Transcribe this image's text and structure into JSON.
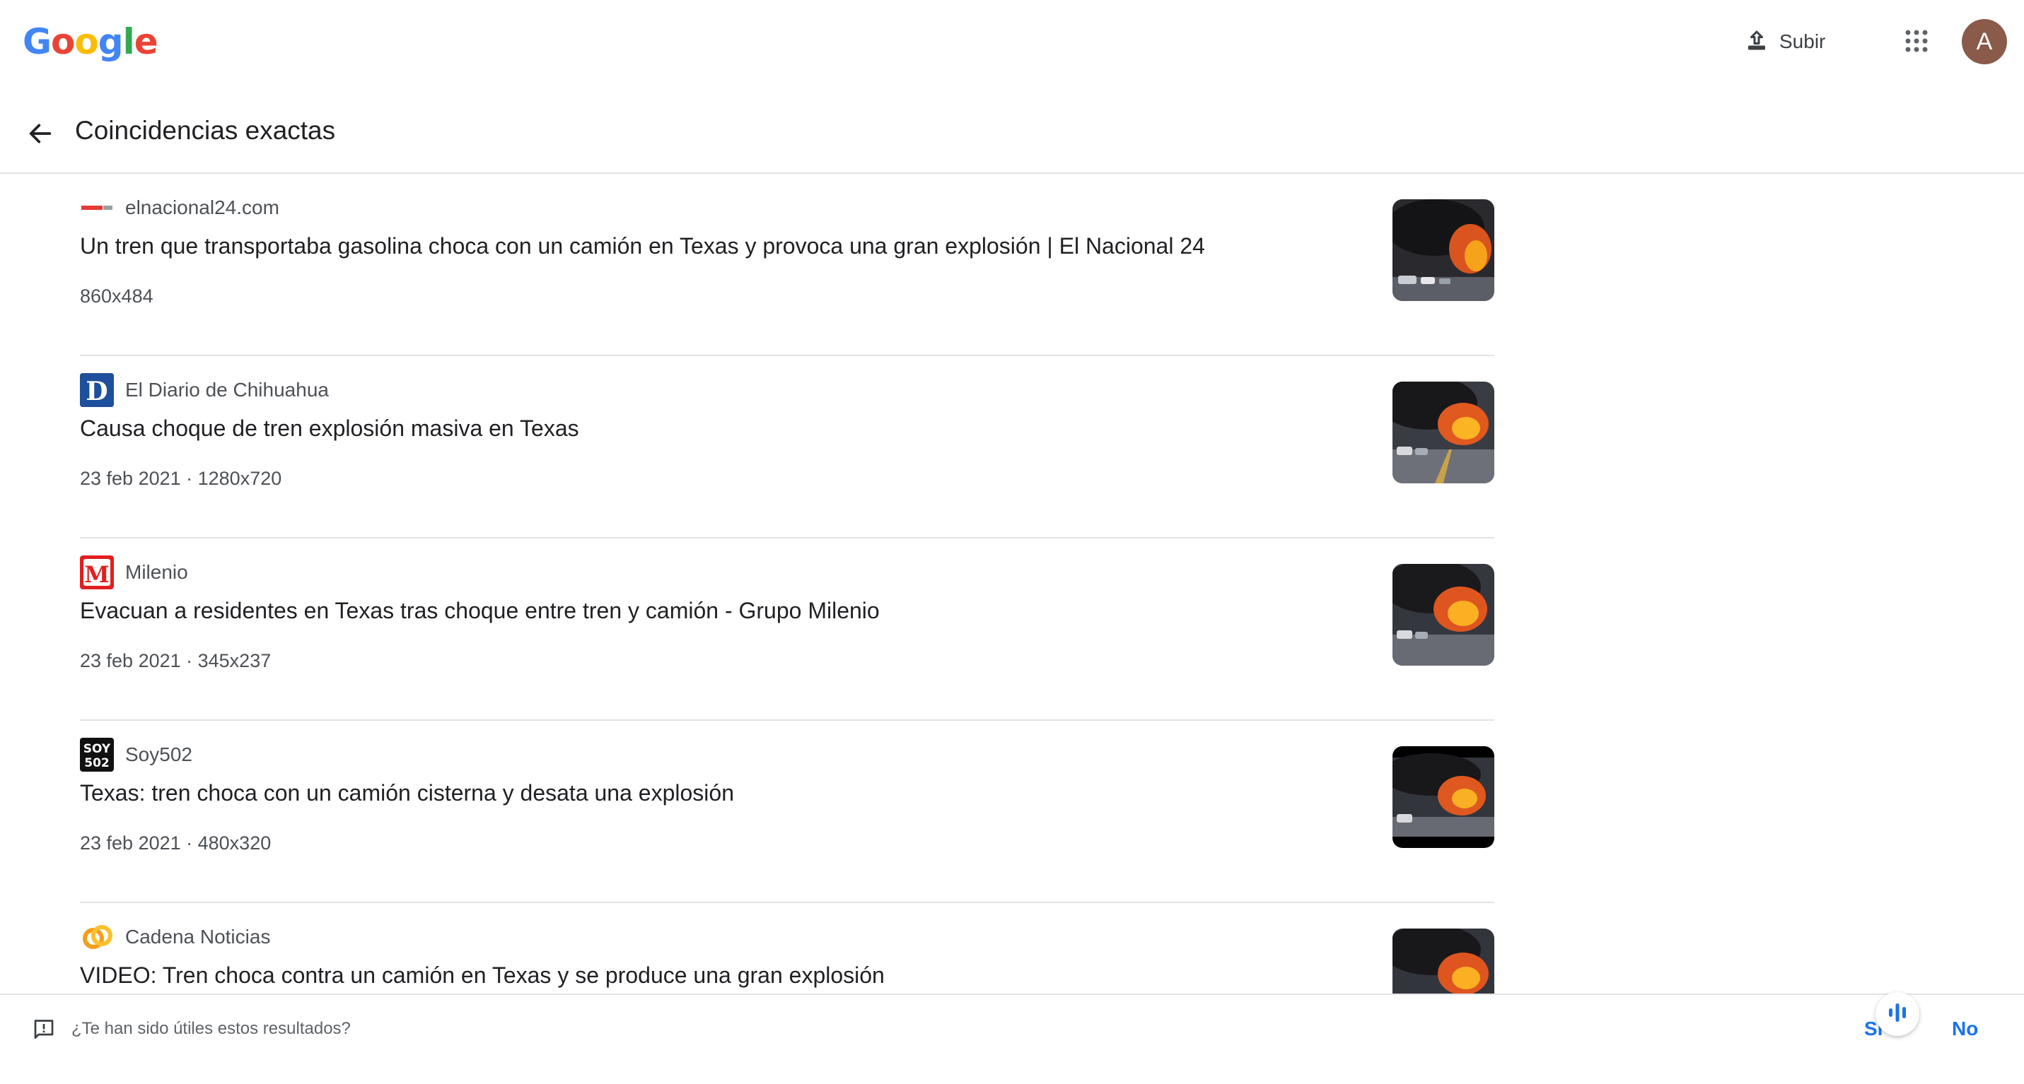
{
  "header": {
    "logo_letters": [
      "G",
      "o",
      "o",
      "g",
      "l",
      "e"
    ],
    "logo_colors": [
      "#4285F4",
      "#EA4335",
      "#FBBC05",
      "#4285F4",
      "#34A853",
      "#EA4335"
    ],
    "upload_label": "Subir",
    "avatar_initial": "A"
  },
  "section": {
    "title": "Coincidencias exactas"
  },
  "results": [
    {
      "source": "elnacional24.com",
      "favicon": "elnacional24-icon",
      "title": "Un tren que transportaba gasolina choca con un camión en Texas y provoca una gran explosión | El Nacional 24",
      "meta": "860x484"
    },
    {
      "source": "El Diario de Chihuahua",
      "favicon": "eldiario-icon",
      "title": "Causa choque de tren explosión masiva en Texas",
      "meta": "23 feb 2021 · 1280x720"
    },
    {
      "source": "Milenio",
      "favicon": "milenio-icon",
      "title": "Evacuan a residentes en Texas tras choque entre tren y camión - Grupo Milenio",
      "meta": "23 feb 2021 · 345x237"
    },
    {
      "source": "Soy502",
      "favicon": "soy502-icon",
      "title": "Texas: tren choca con un camión cisterna y desata una explosión",
      "meta": "23 feb 2021 · 480x320"
    },
    {
      "source": "Cadena Noticias",
      "favicon": "cadenanoticias-icon",
      "title": "VIDEO: Tren choca contra un camión en Texas y se produce una gran explosión",
      "meta": ""
    }
  ],
  "feedback": {
    "question": "¿Te han sido útiles estos resultados?",
    "yes_label": "Sí",
    "no_label": "No"
  },
  "colors": {
    "accent": "#1a73e8",
    "avatar_bg": "#8a5a4a"
  }
}
